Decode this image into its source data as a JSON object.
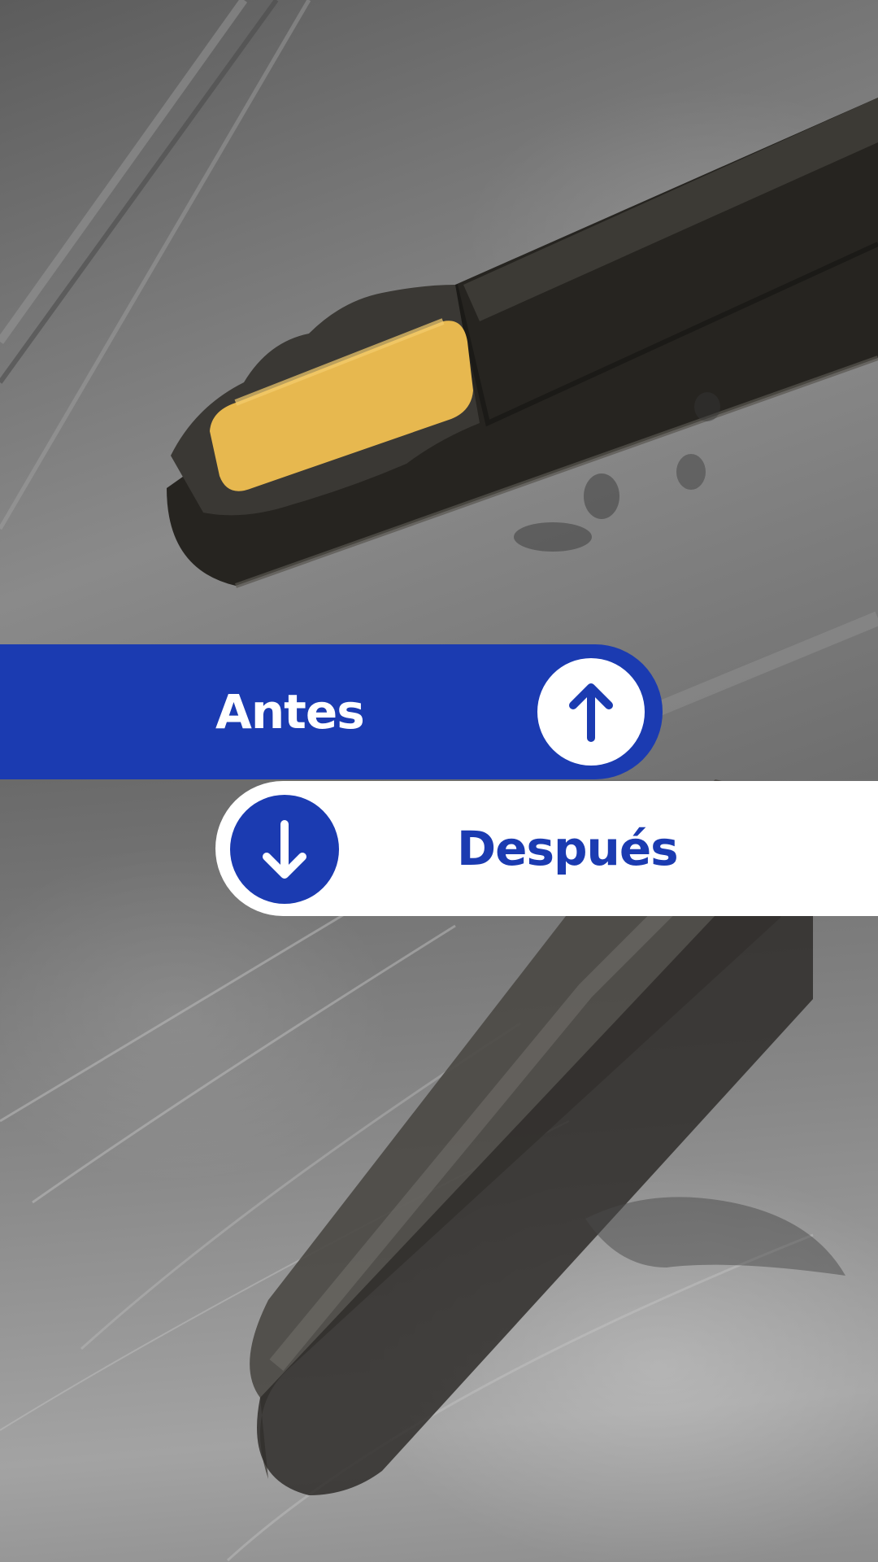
{
  "before": {
    "label": "Antes",
    "icon": "arrow-up-icon"
  },
  "after": {
    "label": "Después",
    "icon": "arrow-down-icon"
  },
  "colors": {
    "brand_blue": "#1b3bb1",
    "white": "#ffffff"
  }
}
